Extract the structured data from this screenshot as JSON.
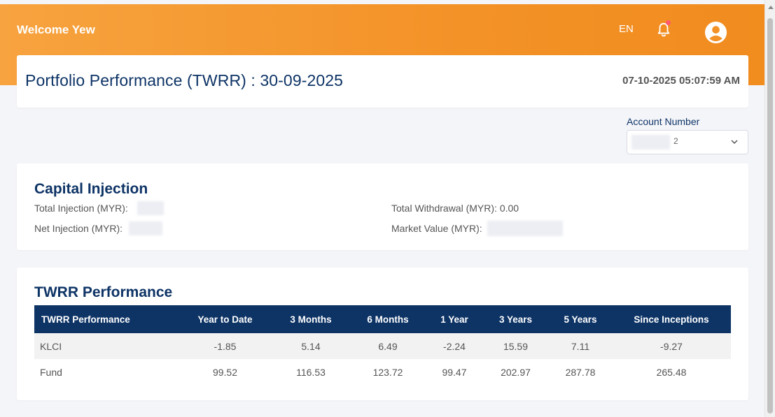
{
  "header": {
    "welcome": "Welcome Yew",
    "language": "EN",
    "brand_color": "#f39227",
    "notification_color": "#ff5a6e"
  },
  "page": {
    "title": "Portfolio Performance (TWRR) : 30-09-2025",
    "timestamp": "07-10-2025 05:07:59 AM"
  },
  "account": {
    "label": "Account Number",
    "value": "2"
  },
  "capital_injection": {
    "title": "Capital Injection",
    "total_injection_label": "Total Injection (MYR): ",
    "total_withdrawal_label": "Total Withdrawal (MYR): ",
    "total_withdrawal_value": "0.00",
    "net_injection_label": "Net Injection (MYR): ",
    "market_value_label": "Market Value (MYR): "
  },
  "twrr": {
    "title": "TWRR Performance",
    "columns": [
      "TWRR Performance",
      "Year to Date",
      "3 Months",
      "6 Months",
      "1 Year",
      "3 Years",
      "5 Years",
      "Since Inceptions"
    ],
    "rows": [
      [
        "KLCI",
        "-1.85",
        "5.14",
        "6.49",
        "-2.24",
        "15.59",
        "7.11",
        "-9.27"
      ],
      [
        "Fund",
        "99.52",
        "116.53",
        "123.72",
        "99.47",
        "202.97",
        "287.78",
        "265.48"
      ]
    ]
  }
}
